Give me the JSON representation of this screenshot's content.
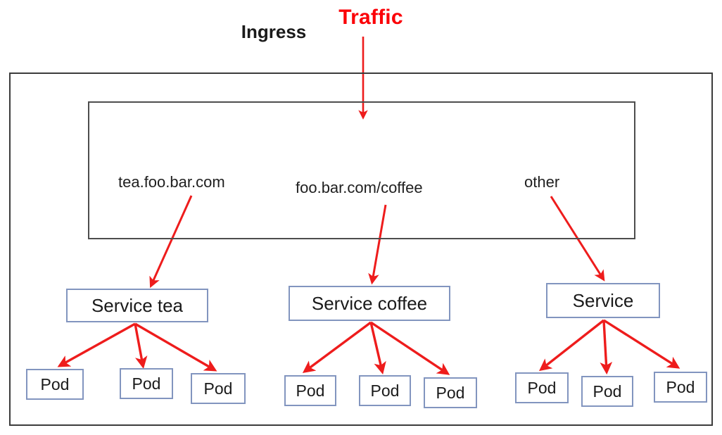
{
  "diagram": {
    "title": "Traffic",
    "cluster": {
      "label": ""
    },
    "ingress": {
      "title": "Ingress"
    },
    "rules": [
      {
        "id": "rule-tea",
        "label": "tea.foo.bar.com"
      },
      {
        "id": "rule-coffee",
        "label": "foo.bar.com/coffee"
      },
      {
        "id": "rule-other",
        "label": "other"
      }
    ],
    "services": [
      {
        "id": "service-tea",
        "label": "Service tea"
      },
      {
        "id": "service-coffee",
        "label": "Service coffee"
      },
      {
        "id": "service-other",
        "label": "Service"
      }
    ],
    "pods": [
      {
        "group": "tea",
        "label": "Pod"
      },
      {
        "group": "tea",
        "label": "Pod"
      },
      {
        "group": "tea",
        "label": "Pod"
      },
      {
        "group": "coffee",
        "label": "Pod"
      },
      {
        "group": "coffee",
        "label": "Pod"
      },
      {
        "group": "coffee",
        "label": "Pod"
      },
      {
        "group": "other",
        "label": "Pod"
      },
      {
        "group": "other",
        "label": "Pod"
      },
      {
        "group": "other",
        "label": "Pod"
      }
    ],
    "colors": {
      "arrow": "#ee1c1c",
      "traffic_text": "#fb0007",
      "cluster_border": "#3c3c3c",
      "ingress_border": "#4d4d4d",
      "node_border": "#8295bf",
      "text": "#1a1a1a",
      "background": "#ffffff"
    }
  }
}
